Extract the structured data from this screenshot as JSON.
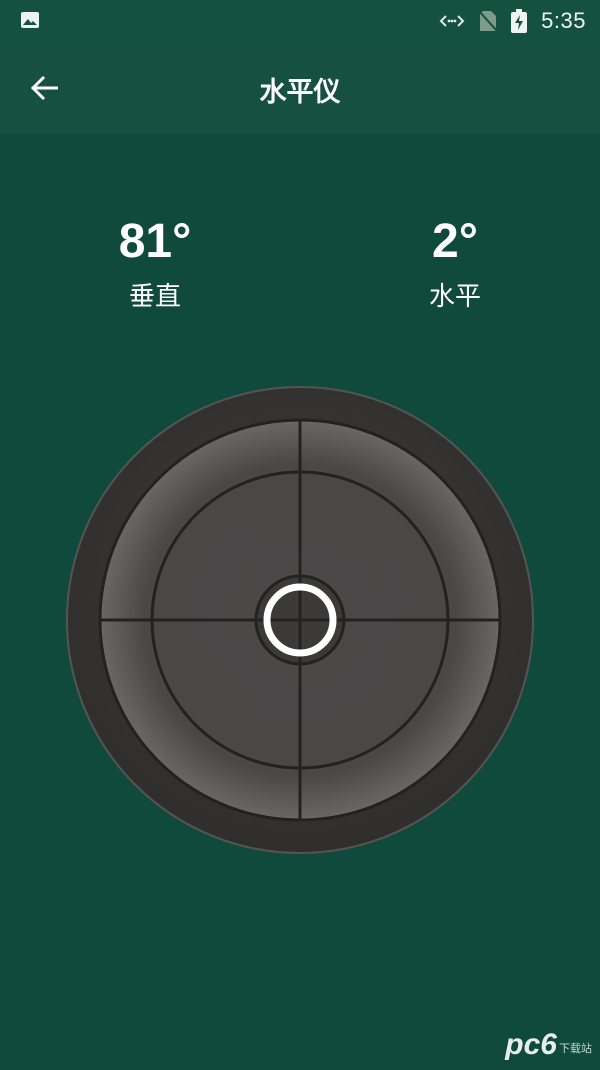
{
  "status_bar": {
    "time": "5:35",
    "icons": [
      "gallery-icon",
      "data-sync-icon",
      "no-sim-icon",
      "battery-charging-icon"
    ]
  },
  "app_bar": {
    "title": "水平仪",
    "back_icon": "arrow-back-icon"
  },
  "readings": {
    "vertical": {
      "value": "81°",
      "label": "垂直"
    },
    "horizontal": {
      "value": "2°",
      "label": "水平"
    }
  },
  "level": {
    "bubble_offset": {
      "x": 0,
      "y": 0
    },
    "colors": {
      "background": "#0f4a3c",
      "bezel": "#3a3a3a",
      "face": "#4a4847",
      "bubble": "#ffffff"
    }
  },
  "watermark": {
    "text": "pc6",
    "sub": "下载站"
  }
}
